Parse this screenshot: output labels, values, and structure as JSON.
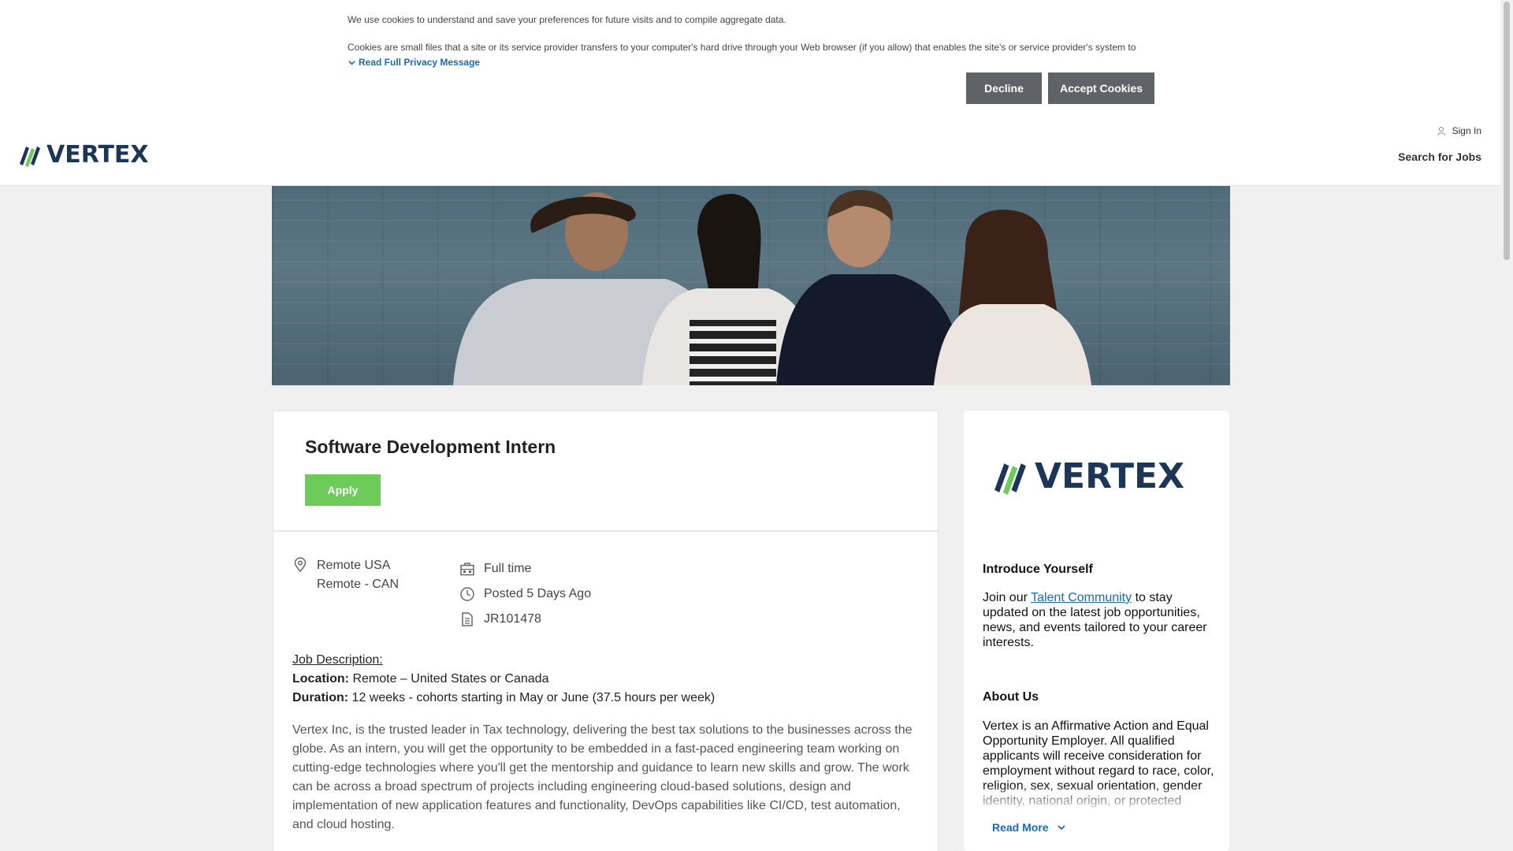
{
  "cookie_banner": {
    "line1": "We use cookies to understand and save your preferences for future visits and to compile aggregate data.",
    "line2": "Cookies are small files that a site or its service provider transfers to your computer's hard drive through your Web browser (if you allow) that enables the site's or service provider's system to",
    "read_full_label": "Read Full Privacy Message",
    "decline_label": "Decline",
    "accept_label": "Accept Cookies"
  },
  "header": {
    "logo_text": "VERTEX",
    "sign_in_label": "Sign In",
    "search_jobs_label": "Search for Jobs"
  },
  "job": {
    "title": "Software Development Intern",
    "apply_label": "Apply",
    "locations": [
      "Remote USA",
      "Remote - CAN"
    ],
    "time_type": "Full time",
    "posted": "Posted 5 Days Ago",
    "req_id": "JR101478",
    "description_heading": "Job Description:",
    "location_label": "Location:",
    "location_value": " Remote – United States or Canada",
    "duration_label": "Duration:",
    "duration_value": " 12 weeks - cohorts starting in May or June (37.5 hours per week)",
    "paragraph": "Vertex Inc, is the trusted leader in Tax technology, delivering the best tax solutions to the businesses across the globe.  As an intern, you will get the opportunity to be embedded in a fast-paced engineering team working on cutting-edge technologies where you'll get the mentorship and guidance to learn new skills and grow.  The work can be across a broad spectrum of projects including engineering cloud-based solutions, design and implementation of new application features and functionality, DevOps capabilities like CI/CD, test automation, and cloud hosting."
  },
  "sidebar": {
    "logo_text": "VERTEX",
    "intro_heading": "Introduce Yourself",
    "intro_prefix": "Join our ",
    "intro_link": "Talent Community",
    "intro_suffix": " to stay updated on the latest job opportunities, news, and events tailored to your career interests.",
    "about_heading": "About Us",
    "about_text": "Vertex is an Affirmative Action and Equal Opportunity Employer. All qualified applicants will receive consideration for employment without regard to race, color, religion, sex, sexual orientation, gender identity, national origin, or protected veteran status.",
    "read_more_label": "Read More"
  },
  "colors": {
    "brand_navy": "#1d3557",
    "brand_green": "#6ccb59",
    "link_blue": "#1a6ab3",
    "button_gray": "#5f6368"
  },
  "icons": [
    "chevron-down-icon",
    "user-icon",
    "location-pin-icon",
    "briefcase-icon",
    "clock-icon",
    "document-icon"
  ]
}
